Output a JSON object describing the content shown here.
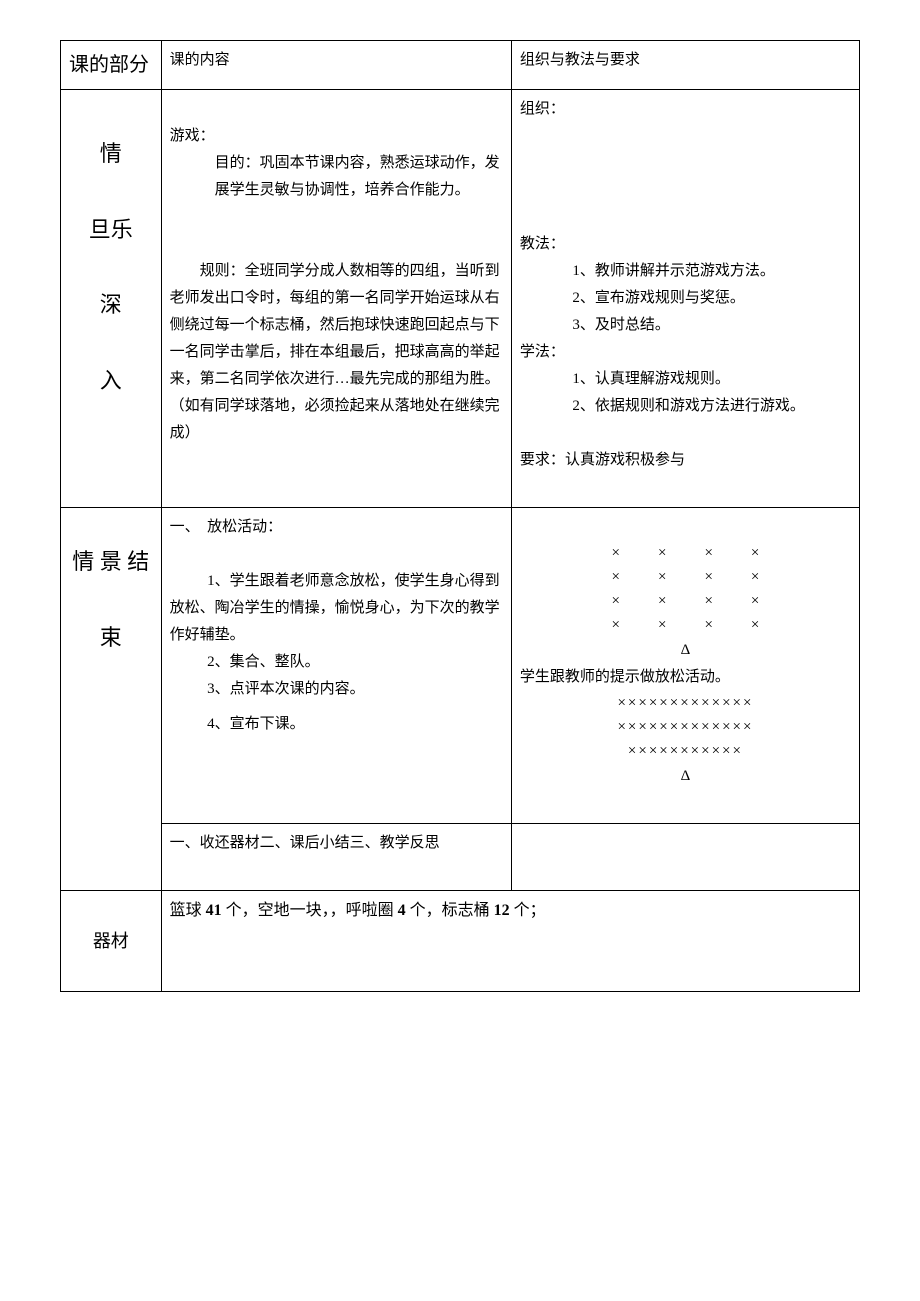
{
  "headers": {
    "section": "课的部分",
    "content": "课的内容",
    "method": "组织与教法与要求"
  },
  "row1": {
    "section_chars": [
      "情",
      "旦乐",
      "深",
      "入"
    ],
    "content": {
      "game_label": "游戏：",
      "purpose_label": "目的：",
      "purpose_text": "巩固本节课内容，熟悉运球动作，发展学生灵敏与协调性，培养合作能力。",
      "rule_label": "规则：",
      "rule_text": "全班同学分成人数相等的四组，当听到老师发出口令时，每组的第一名同学开始运球从右侧绕过每一个标志桶，然后抱球快速跑回起点与下一名同学击掌后，排在本组最后，把球高高的举起来，第二名同学依次进行…最先完成的那组为胜。（如有同学球落地，必须捡起来从落地处在继续完成）"
    },
    "method": {
      "org_label": "组织：",
      "teach_label": "教法：",
      "teach_items": {
        "t1": "1、教师讲解并示范游戏方法。",
        "t2": "2、宣布游戏规则与奖惩。",
        "t3": "3、及时总结。"
      },
      "learn_label": "学法：",
      "learn_items": {
        "l1": "1、认真理解游戏规则。",
        "l2": "2、依据规则和游戏方法进行游戏。"
      },
      "req_label": "要求：",
      "req_text": "认真游戏积极参与"
    }
  },
  "row2": {
    "section_chars": [
      "情 景 结",
      "束"
    ],
    "content": {
      "relax_label": "一、　放松活动：",
      "relax_items": {
        "r1": "1、学生跟着老师意念放松，使学生身心得到放松、陶冶学生的情操，愉悦身心，为下次的教学作好辅垫。",
        "r2": "2、集合、整队。",
        "r3": "3、点评本次课的内容。",
        "r4": "4、宣布下课。"
      }
    },
    "method": {
      "x_rows": "×",
      "triangle": "Δ",
      "follow_text": "学生跟教师的提示做放松活动。",
      "x_line1": "×××××××××××××",
      "x_line2": "×××××××××××××",
      "x_line3": "×××××××××××"
    }
  },
  "row3": {
    "content": "一、收还器材二、课后小结三、教学反思"
  },
  "row4": {
    "section": "器材",
    "content_parts": {
      "p1": "篮球 ",
      "n1": "41",
      "p2": " 个，空地一块，，呼啦圈 ",
      "n2": "4",
      "p3": " 个，标志桶 ",
      "n3": "12",
      "p4": " 个；"
    }
  }
}
